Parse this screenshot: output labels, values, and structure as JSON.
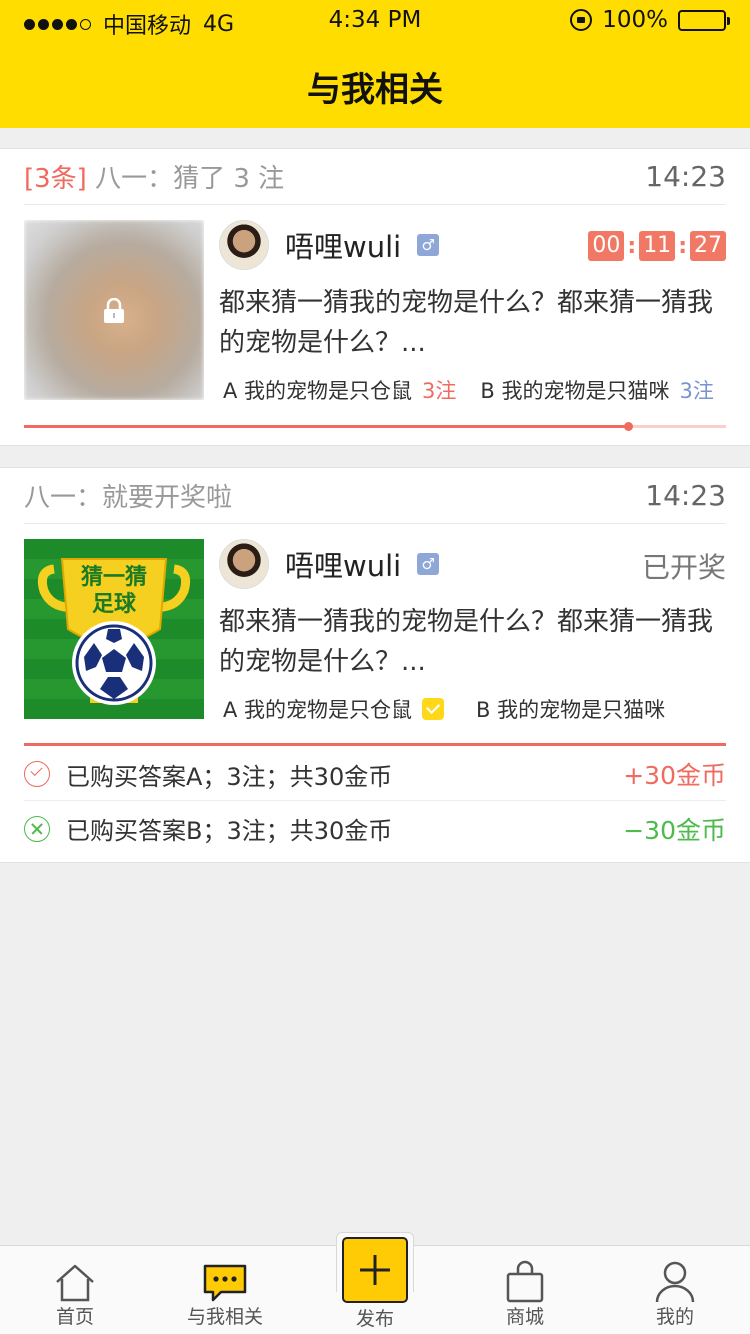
{
  "status_bar": {
    "carrier": "中国移动",
    "network": "4G",
    "time": "4:34 PM",
    "battery": "100%"
  },
  "header": {
    "title": "与我相关"
  },
  "cards": [
    {
      "count_badge": "[3条]",
      "summary": "八一：猜了 3 注",
      "time": "14:23",
      "image": "blurred-pet-photo",
      "lock_icon": "lock-icon",
      "user": {
        "name": "唔哩wuli",
        "gender": "♂"
      },
      "countdown": {
        "h": "00",
        "m": "11",
        "s": "27"
      },
      "question": "都来猜一猜我的宠物是什么？都来猜一猜我的宠物是什么？...",
      "options": [
        {
          "label": "A 我的宠物是只仓鼠",
          "bets": "3注"
        },
        {
          "label": "B 我的宠物是只猫咪",
          "bets": "3注"
        }
      ],
      "progress": 0.86
    },
    {
      "summary": "八一：就要开奖啦",
      "time": "14:23",
      "image_text": [
        "猜一猜",
        "足球"
      ],
      "user": {
        "name": "唔哩wuli",
        "gender": "♂"
      },
      "status": "已开奖",
      "question": "都来猜一猜我的宠物是什么？都来猜一猜我的宠物是什么？...",
      "options": [
        {
          "label": "A 我的宠物是只仓鼠",
          "checked": true
        },
        {
          "label": "B 我的宠物是只猫咪"
        }
      ],
      "results": [
        {
          "text": "已购买答案A；3注；共30金币",
          "amount": "+30金币",
          "icon": "check-circle-icon"
        },
        {
          "text": "已购买答案B；3注；共30金币",
          "amount": "−30金币",
          "icon": "x-circle-icon"
        }
      ]
    }
  ],
  "tabbar": {
    "items": [
      {
        "label": "首页",
        "icon": "home-icon"
      },
      {
        "label": "与我相关",
        "icon": "chat-icon"
      },
      {
        "label": "发布",
        "icon": "plus-icon"
      },
      {
        "label": "商城",
        "icon": "bag-icon"
      },
      {
        "label": "我的",
        "icon": "user-icon"
      }
    ]
  },
  "colors": {
    "brand_yellow": "#ffdd00",
    "accent_red": "#f06a5f",
    "accent_green": "#4cbb4c",
    "accent_blue": "#7a92cf"
  }
}
